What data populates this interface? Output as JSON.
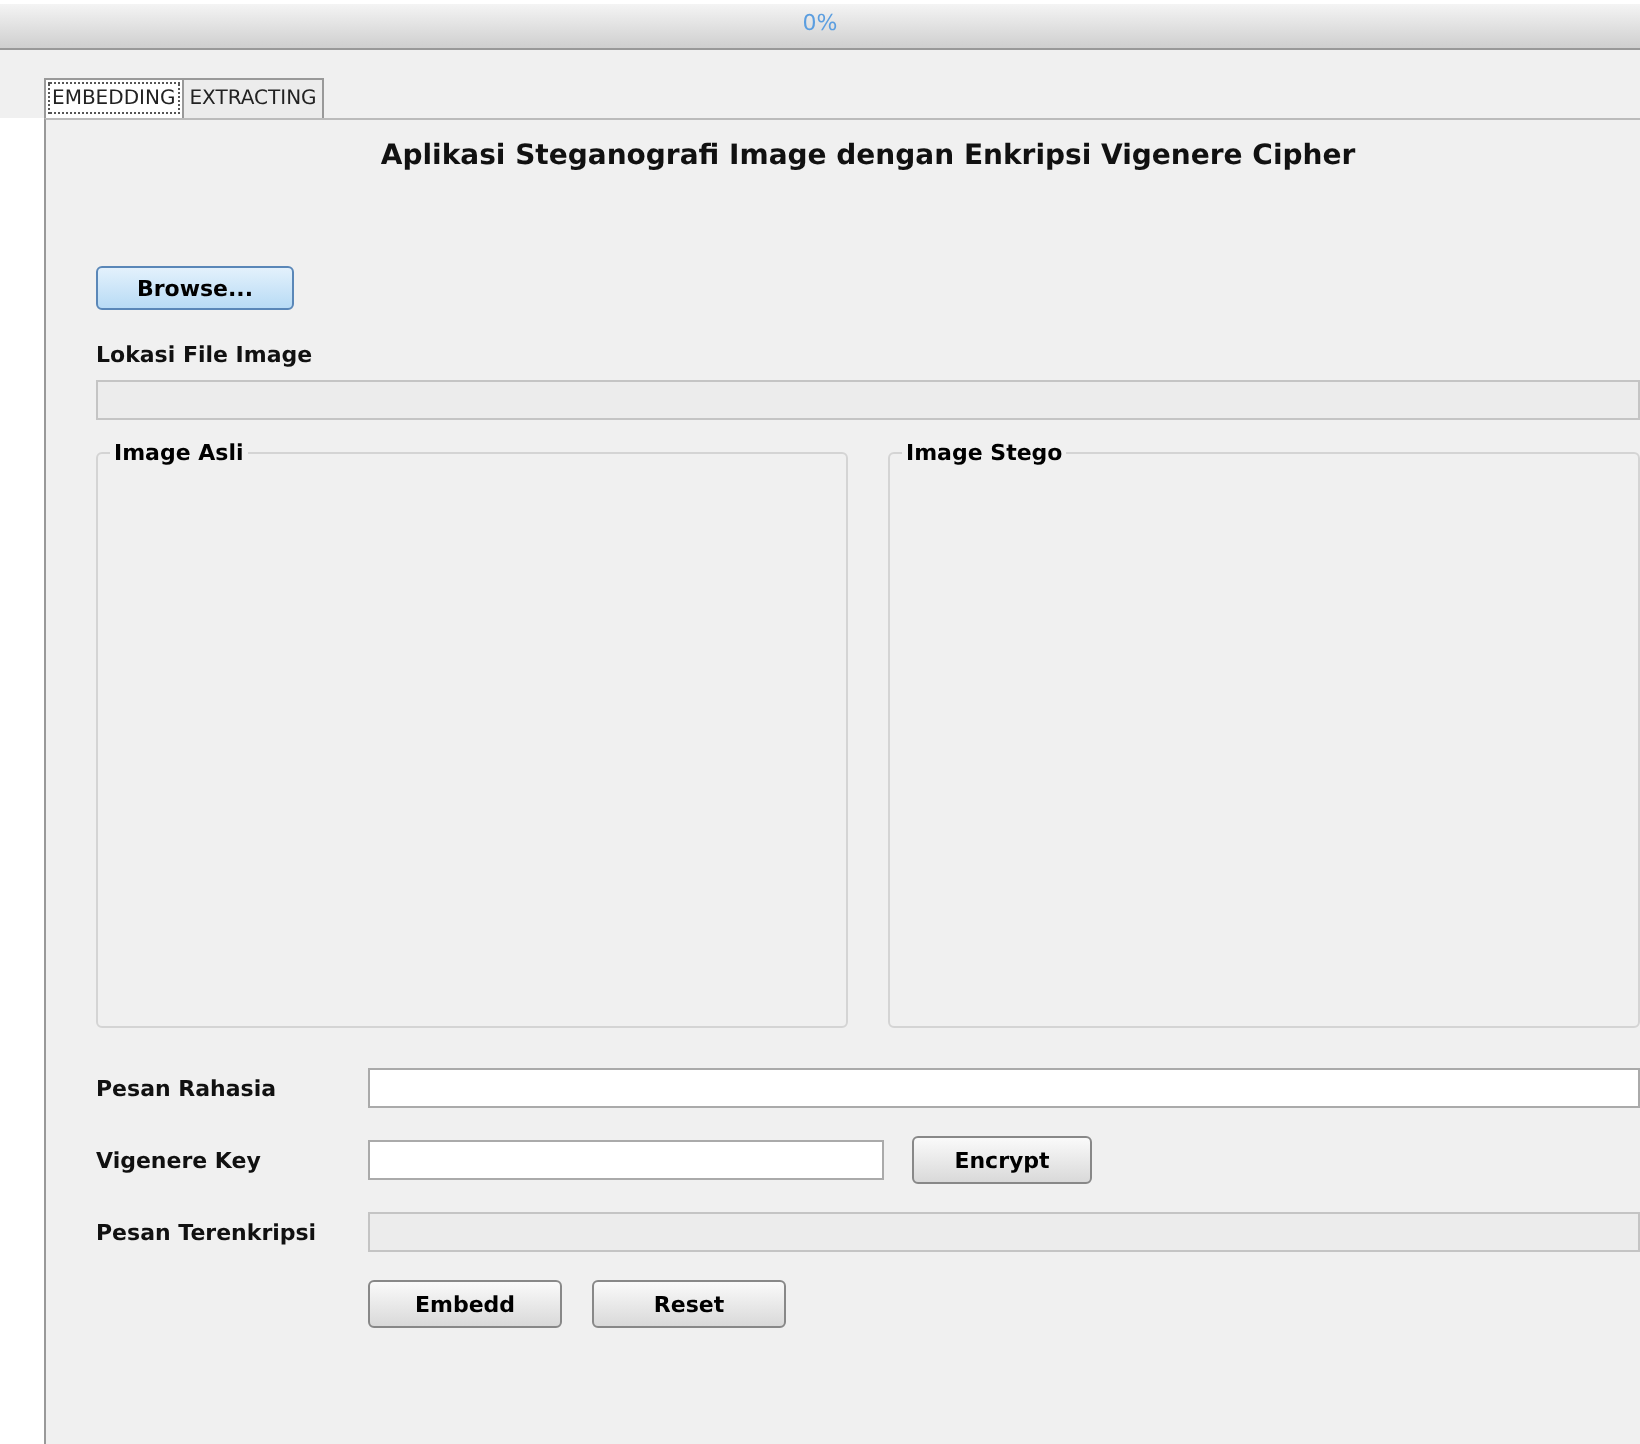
{
  "progress": {
    "level": 0,
    "text": "0%"
  },
  "tabs": [
    {
      "label": "EMBEDDING",
      "selected": true
    },
    {
      "label": "EXTRACTING",
      "selected": false
    }
  ],
  "title": "Aplikasi Steganografi Image dengan Enkripsi Vigenere Cipher",
  "browse_button": "Browse...",
  "file_location": {
    "label": "Lokasi File Image",
    "disabled": true
  },
  "image_panels": [
    {
      "title": "Image Asli"
    },
    {
      "title": "Image Stego"
    }
  ],
  "form_rows": [
    {
      "label": "Pesan Rahasia",
      "kind": "wide",
      "disabled": false
    },
    {
      "label": "Vigenere Key",
      "kind": "button",
      "disabled": false,
      "button": "Encrypt"
    },
    {
      "label": "Pesan Terenkripsi",
      "kind": "wide",
      "disabled": true
    }
  ],
  "buttons": [
    "Embedd",
    "Reset"
  ]
}
